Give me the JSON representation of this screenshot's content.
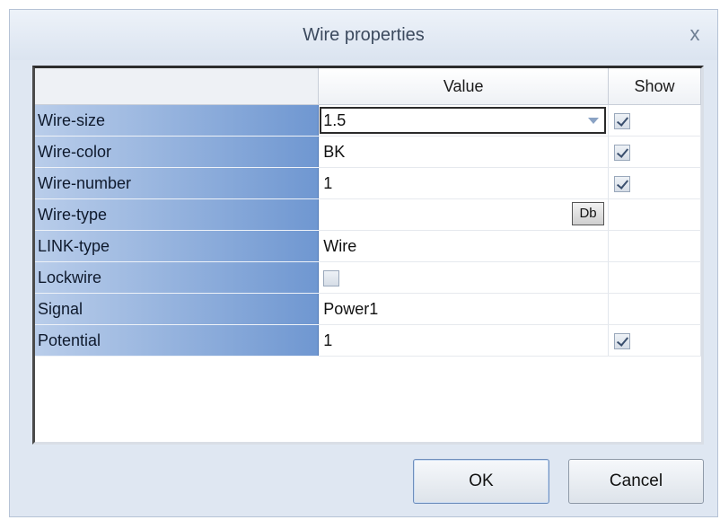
{
  "window": {
    "title": "Wire properties",
    "close_glyph": "x",
    "close_icon": "close-icon"
  },
  "grid": {
    "headers": {
      "property": "",
      "value": "Value",
      "show": "Show"
    },
    "rows": [
      {
        "property": "Wire-size",
        "value": "1.5",
        "control": "dropdown",
        "show": true
      },
      {
        "property": "Wire-color",
        "value": "BK",
        "control": "text",
        "show": true
      },
      {
        "property": "Wire-number",
        "value": "1",
        "control": "text",
        "show": true
      },
      {
        "property": "Wire-type",
        "value": "",
        "control": "db-button",
        "show": null,
        "button_label": "Db"
      },
      {
        "property": "LINK-type",
        "value": "Wire",
        "control": "text",
        "show": null
      },
      {
        "property": "Lockwire",
        "value": false,
        "control": "checkbox",
        "show": null
      },
      {
        "property": "Signal",
        "value": "Power1",
        "control": "text",
        "show": null
      },
      {
        "property": "Potential",
        "value": "1",
        "control": "text",
        "show": true
      }
    ]
  },
  "buttons": {
    "ok": "OK",
    "cancel": "Cancel"
  }
}
